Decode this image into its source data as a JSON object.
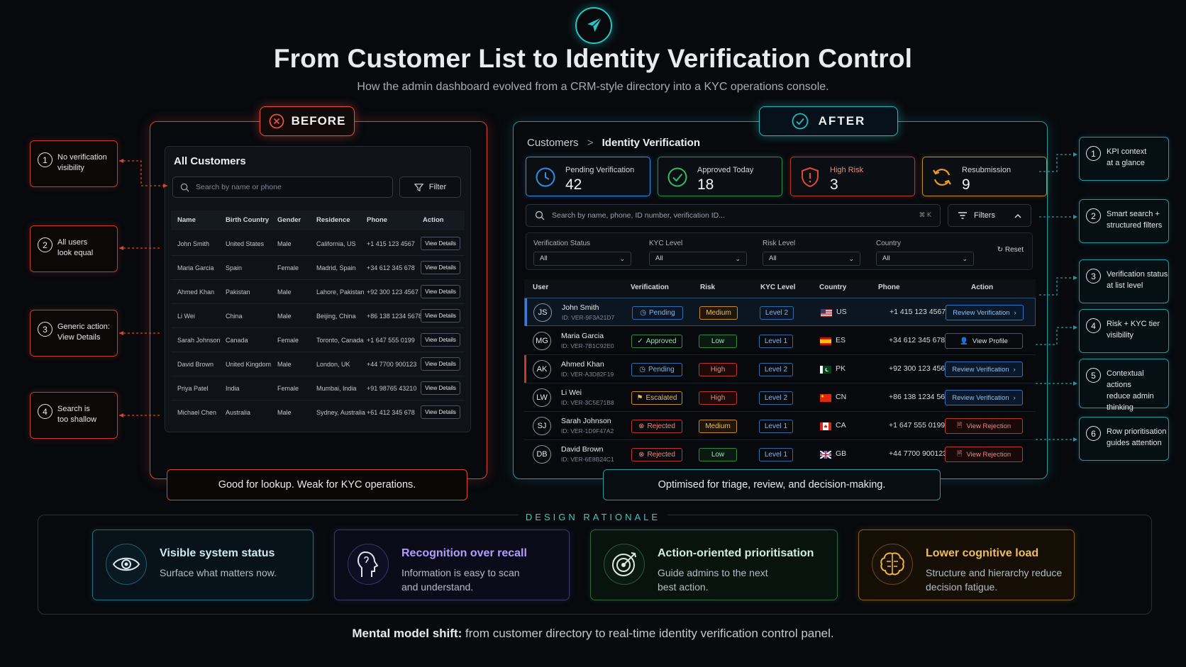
{
  "header": {
    "title": "From Customer List to Identity Verification Control",
    "subtitle": "How the admin dashboard evolved from a CRM-style directory into a KYC operations console."
  },
  "before": {
    "badge": "BEFORE",
    "card_title": "All Customers",
    "search_placeholder": "Search by name or phone",
    "filter_label": "Filter",
    "columns": [
      "Name",
      "Birth Country",
      "Gender",
      "Residence",
      "Phone",
      "Action"
    ],
    "rows": [
      {
        "name": "John Smith",
        "birth": "United States",
        "gender": "Male",
        "residence": "California, US",
        "phone": "+1 415 123 4567",
        "action": "View Details"
      },
      {
        "name": "Maria Garcia",
        "birth": "Spain",
        "gender": "Female",
        "residence": "Madrid, Spain",
        "phone": "+34 612 345 678",
        "action": "View Details"
      },
      {
        "name": "Ahmed Khan",
        "birth": "Pakistan",
        "gender": "Male",
        "residence": "Lahore, Pakistan",
        "phone": "+92 300 123 4567",
        "action": "View Details"
      },
      {
        "name": "Li Wei",
        "birth": "China",
        "gender": "Male",
        "residence": "Beijing, China",
        "phone": "+86 138 1234 5678",
        "action": "View Details"
      },
      {
        "name": "Sarah Johnson",
        "birth": "Canada",
        "gender": "Female",
        "residence": "Toronto, Canada",
        "phone": "+1 647 555 0199",
        "action": "View Details"
      },
      {
        "name": "David Brown",
        "birth": "United Kingdom",
        "gender": "Male",
        "residence": "London, UK",
        "phone": "+44 7700 900123",
        "action": "View Details"
      },
      {
        "name": "Priya Patel",
        "birth": "India",
        "gender": "Female",
        "residence": "Mumbai, India",
        "phone": "+91 98765 43210",
        "action": "View Details"
      },
      {
        "name": "Michael Chen",
        "birth": "Australia",
        "gender": "Male",
        "residence": "Sydney, Australia",
        "phone": "+61 412 345 678",
        "action": "View Details"
      }
    ],
    "caption": "Good for lookup. Weak for KYC operations.",
    "callouts": [
      {
        "num": "1",
        "line1": "No verification",
        "line2": "visibility"
      },
      {
        "num": "2",
        "line1": "All users",
        "line2": "look equal"
      },
      {
        "num": "3",
        "line1": "Generic action:",
        "line2": "View Details"
      },
      {
        "num": "4",
        "line1": "Search is",
        "line2": "too shallow"
      }
    ]
  },
  "after": {
    "badge": "AFTER",
    "breadcrumb_root": "Customers",
    "breadcrumb_sep": ">",
    "breadcrumb_current": "Identity Verification",
    "kpis": [
      {
        "label": "Pending Verification",
        "value": "42",
        "color": "#2f8fe0",
        "icon": "clock-icon"
      },
      {
        "label": "Approved Today",
        "value": "18",
        "color": "#37b864",
        "icon": "check-circle-icon"
      },
      {
        "label": "High Risk",
        "value": "3",
        "color": "#e0493a",
        "icon": "shield-alert-icon"
      },
      {
        "label": "Resubmission",
        "value": "9",
        "color": "#e89a24",
        "icon": "refresh-icon"
      }
    ],
    "search_placeholder": "Search by name, phone, ID number, verification ID...",
    "search_shortcut": "⌘ K",
    "filters_label": "Filters",
    "filter_groups": [
      {
        "label": "Verification Status",
        "value": "All"
      },
      {
        "label": "KYC Level",
        "value": "All"
      },
      {
        "label": "Risk Level",
        "value": "All"
      },
      {
        "label": "Country",
        "value": "All"
      }
    ],
    "reset_label": "Reset",
    "columns": [
      "User",
      "Verification",
      "Risk",
      "KYC Level",
      "Country",
      "Phone",
      "Action"
    ],
    "rows": [
      {
        "initials": "JS",
        "name": "John Smith",
        "id": "ID: VER-9F3A21D7",
        "status": "Pending",
        "risk": "Medium",
        "kyc": "Level 2",
        "country": "US",
        "phone": "+1 415 123 4567",
        "action": "Review Verification"
      },
      {
        "initials": "MG",
        "name": "Maria Garcia",
        "id": "ID: VER-7B1C92E0",
        "status": "Approved",
        "risk": "Low",
        "kyc": "Level 1",
        "country": "ES",
        "phone": "+34 612 345 678",
        "action": "View Profile"
      },
      {
        "initials": "AK",
        "name": "Ahmed Khan",
        "id": "ID: VER-A3D82F19",
        "status": "Pending",
        "risk": "High",
        "kyc": "Level 2",
        "country": "PK",
        "phone": "+92 300 123 4567",
        "action": "Review Verification"
      },
      {
        "initials": "LW",
        "name": "Li Wei",
        "id": "ID: VER-3C5E71B8",
        "status": "Escalated",
        "risk": "High",
        "kyc": "Level 2",
        "country": "CN",
        "phone": "+86 138 1234 5678",
        "action": "Review Verification"
      },
      {
        "initials": "SJ",
        "name": "Sarah Johnson",
        "id": "ID: VER-1D9F47A2",
        "status": "Rejected",
        "risk": "Medium",
        "kyc": "Level 1",
        "country": "CA",
        "phone": "+1 647 555 0199",
        "action": "View Rejection"
      },
      {
        "initials": "DB",
        "name": "David Brown",
        "id": "ID: VER-6E8B24C1",
        "status": "Rejected",
        "risk": "Low",
        "kyc": "Level 1",
        "country": "GB",
        "phone": "+44 7700 900123",
        "action": "View Rejection"
      }
    ],
    "caption": "Optimised for triage, review, and decision-making.",
    "callouts": [
      {
        "num": "1",
        "line1": "KPI context",
        "line2": "at a glance",
        "line3": ""
      },
      {
        "num": "2",
        "line1": "Smart search +",
        "line2": "structured filters",
        "line3": ""
      },
      {
        "num": "3",
        "line1": "Verification status",
        "line2": "at list level",
        "line3": ""
      },
      {
        "num": "4",
        "line1": "Risk + KYC tier",
        "line2": "visibility",
        "line3": ""
      },
      {
        "num": "5",
        "line1": "Contextual actions",
        "line2": "reduce admin",
        "line3": "thinking"
      },
      {
        "num": "6",
        "line1": "Row prioritisation",
        "line2": "guides attention",
        "line3": ""
      }
    ]
  },
  "rationale": {
    "title": "DESIGN RATIONALE",
    "cards": [
      {
        "title": "Visible system status",
        "line1": "Surface what matters now.",
        "line2": "",
        "color": "#2ab3c6",
        "icon": "eye-icon"
      },
      {
        "title": "Recognition over recall",
        "line1": "Information is easy to scan",
        "line2": "and understand.",
        "color": "#8a6cf0",
        "icon": "head-icon"
      },
      {
        "title": "Action-oriented prioritisation",
        "line1": "Guide admins to the next",
        "line2": "best action.",
        "color": "#3db26a",
        "icon": "target-icon"
      },
      {
        "title": "Lower cognitive load",
        "line1": "Structure and hierarchy reduce",
        "line2": "decision fatigue.",
        "color": "#e89a24",
        "icon": "brain-icon"
      }
    ]
  },
  "footer": {
    "lead": "Mental model shift:",
    "text": " from customer directory to real-time identity verification control panel."
  },
  "colors": {
    "before_accent": "#d9462b",
    "after_accent": "#1d9da3",
    "brand": "#25c8c2"
  }
}
